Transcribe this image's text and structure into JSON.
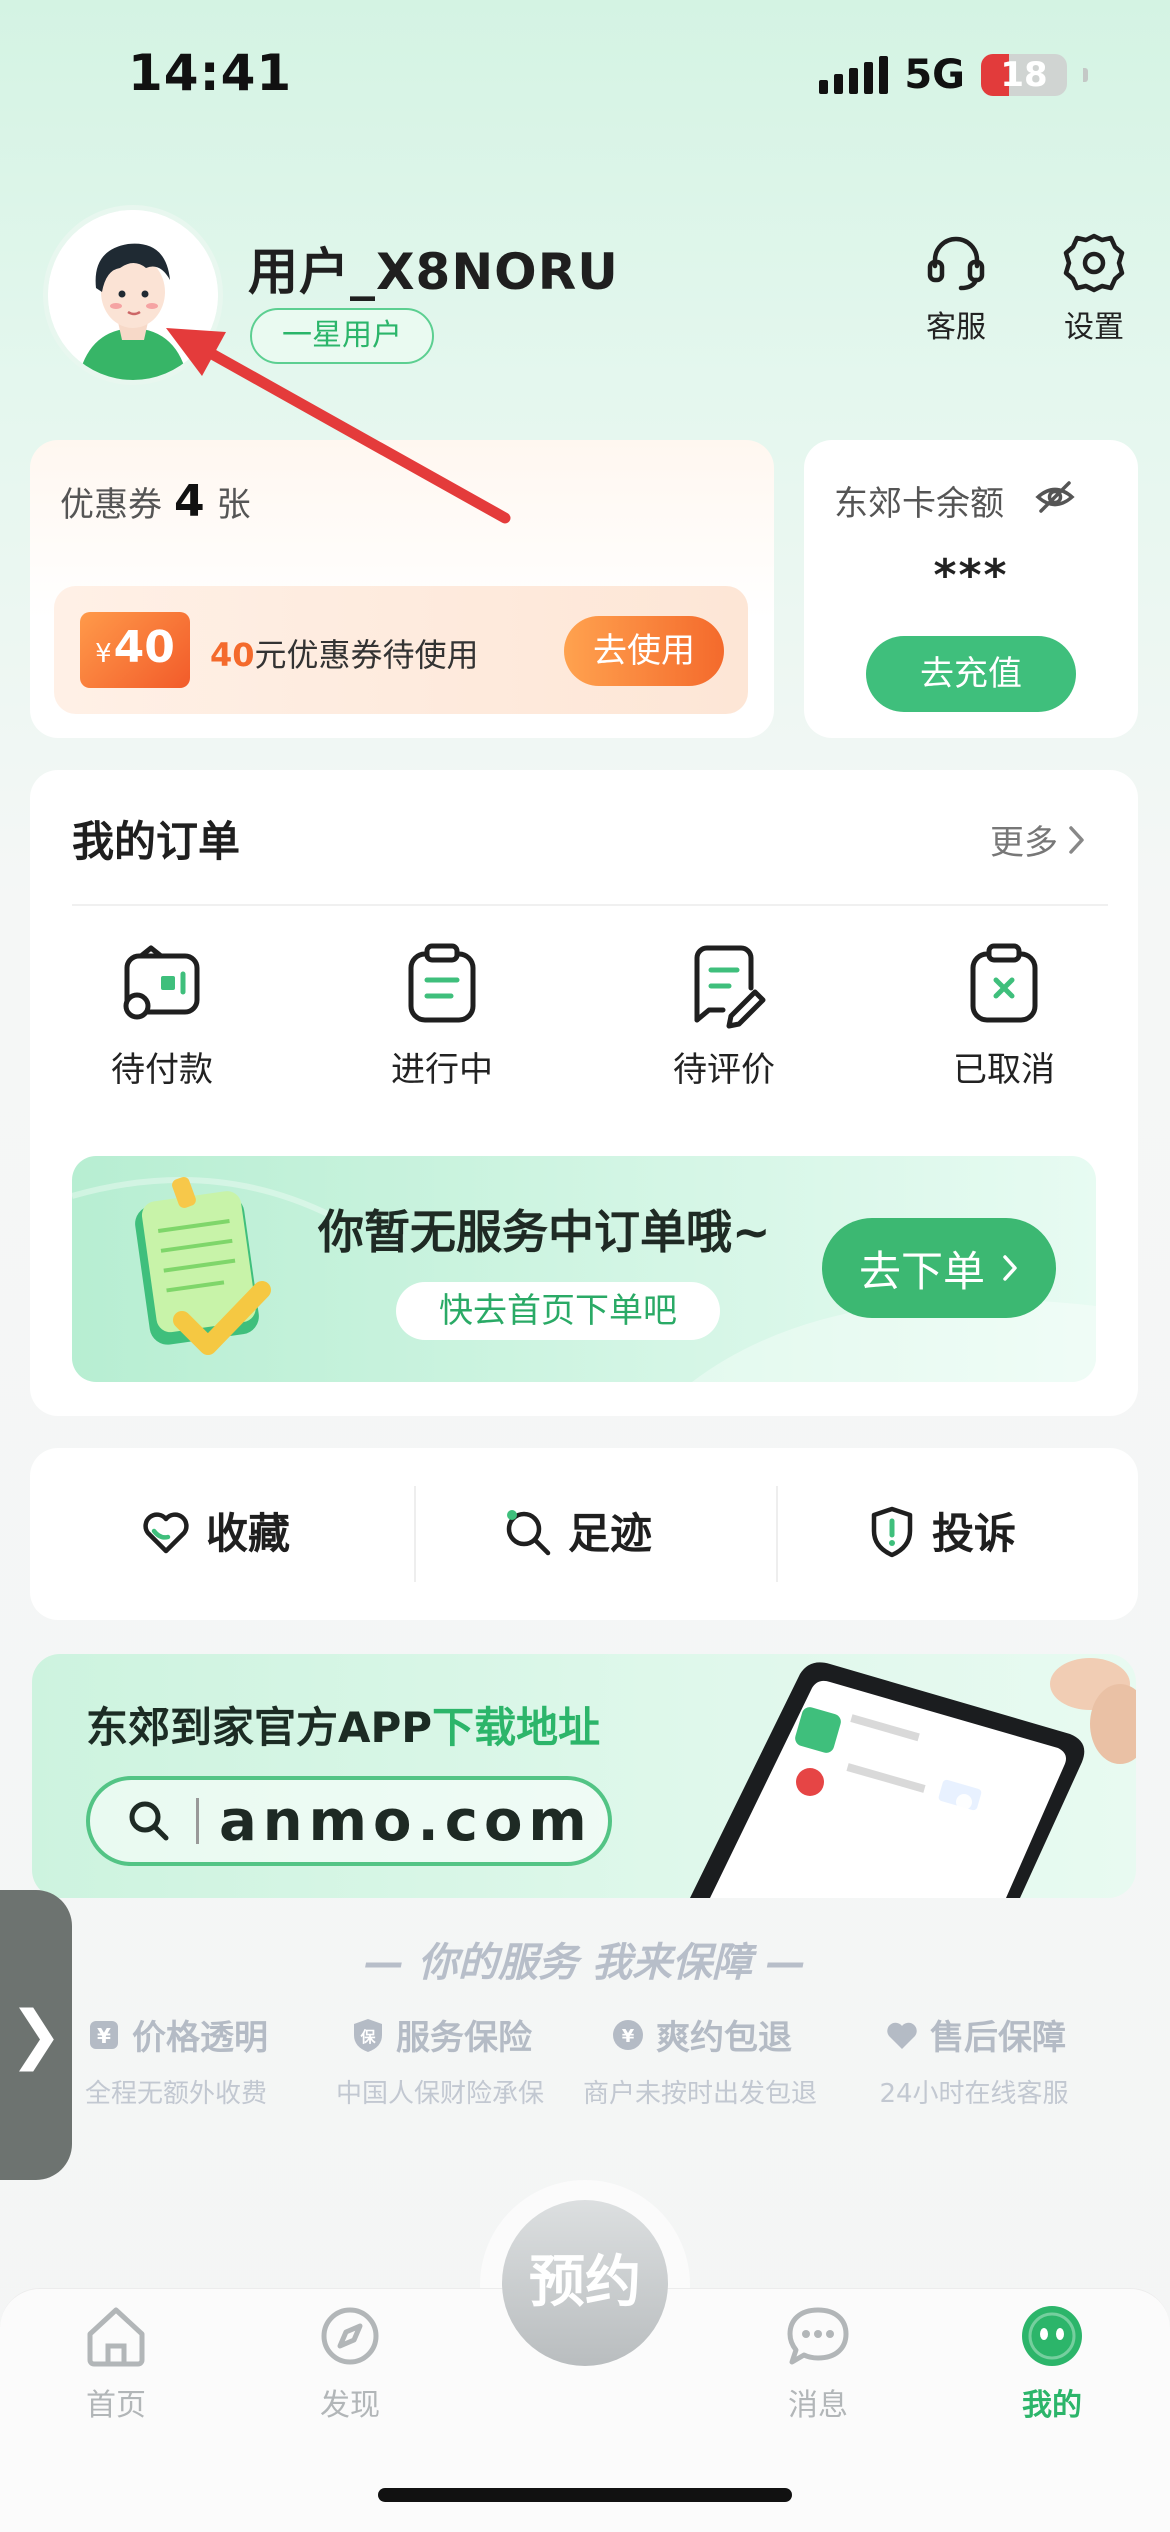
{
  "status_bar": {
    "time": "14:41",
    "network": "5G",
    "battery": "18"
  },
  "profile": {
    "username": "用户_X8NORU",
    "level": "一星用户"
  },
  "top_actions": {
    "customer_service": "客服",
    "settings": "设置"
  },
  "coupon": {
    "label": "优惠券",
    "count": "4",
    "unit": "张",
    "ticket_currency": "¥",
    "ticket_amount": "40",
    "desc_amount": "40",
    "desc_text": "元优惠券待使用",
    "use_button": "去使用"
  },
  "balance": {
    "label": "东郊卡余额",
    "value": "***",
    "recharge_button": "去充值"
  },
  "orders": {
    "title": "我的订单",
    "more": "更多",
    "items": [
      {
        "label": "待付款"
      },
      {
        "label": "进行中"
      },
      {
        "label": "待评价"
      },
      {
        "label": "已取消"
      }
    ],
    "empty_text": "你暂无服务中订单哦~",
    "empty_sub": "快去首页下单吧",
    "order_button": "去下单"
  },
  "quick_actions": [
    {
      "label": "收藏"
    },
    {
      "label": "足迹"
    },
    {
      "label": "投诉"
    }
  ],
  "app_banner": {
    "title_prefix": "东郊到家官方APP",
    "title_highlight": "下载地址",
    "url": "anmo.com"
  },
  "guarantee": {
    "title": "— 你的服务 我来保障 —",
    "items": [
      {
        "title": "价格透明",
        "sub": "全程无额外收费"
      },
      {
        "title": "服务保险",
        "sub": "中国人保财险承保"
      },
      {
        "title": "爽约包退",
        "sub": "商户未按时出发包退"
      },
      {
        "title": "售后保障",
        "sub": "24小时在线客服"
      }
    ]
  },
  "side_handle": "❯",
  "bottom_nav": {
    "center": "预约",
    "items": [
      {
        "label": "首页"
      },
      {
        "label": "发现"
      },
      {
        "label": "消息"
      },
      {
        "label": "我的"
      }
    ],
    "active_color": "#2cb56a"
  },
  "colors": {
    "brand_green": "#3fbf7c",
    "accent_orange": "#f46a2c",
    "annotation_red": "#e43b3b"
  }
}
